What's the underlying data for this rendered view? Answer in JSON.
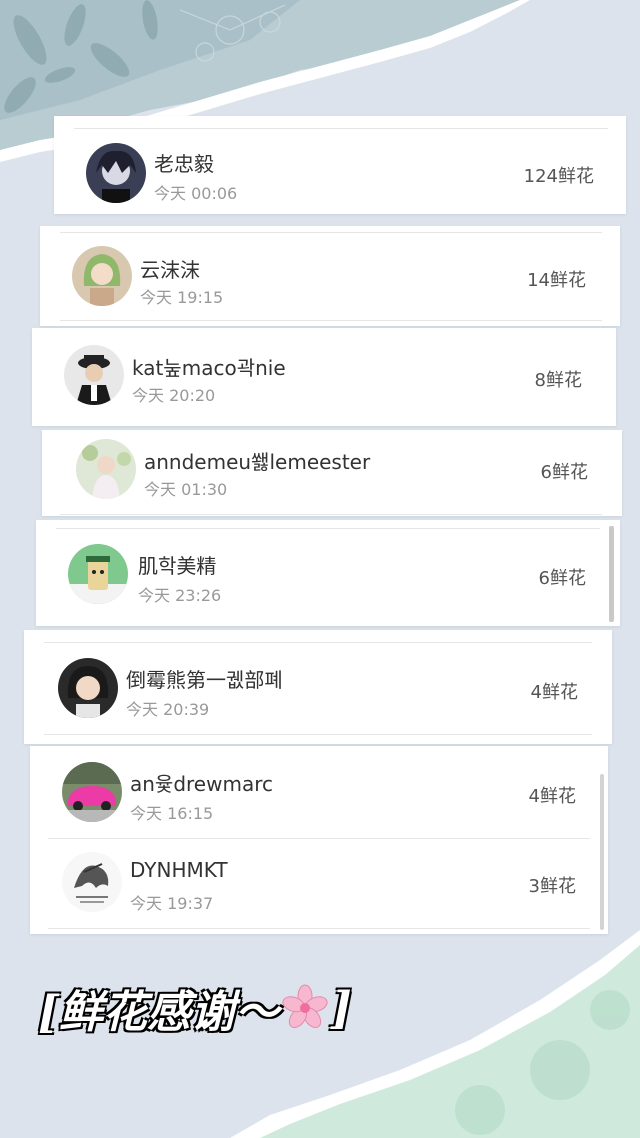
{
  "rows": [
    {
      "name": "老忠毅",
      "time": "今天 00:06",
      "flowers": "124鲜花",
      "avatar": "avatar-dark-anime"
    },
    {
      "name": "云沫沫",
      "time": "今天 19:15",
      "flowers": "14鲜花",
      "avatar": "avatar-green-hair"
    },
    {
      "name": "kat눞maco곽nie",
      "time": "今天 20:20",
      "flowers": "8鲜花",
      "avatar": "avatar-man-hat"
    },
    {
      "name": "anndemeu쐟lemeester",
      "time": "今天 01:30",
      "flowers": "6鲜花",
      "avatar": "avatar-girl-flowers"
    },
    {
      "name": "肌학美精",
      "time": "今天 23:26",
      "flowers": "6鲜花",
      "avatar": "avatar-cartoon-cup"
    },
    {
      "name": "倒霉熊第一궶部폐",
      "time": "今天 20:39",
      "flowers": "4鲜花",
      "avatar": "avatar-girl-portrait"
    },
    {
      "name": "an윷drewmarc",
      "time": "今天 16:15",
      "flowers": "4鲜花",
      "avatar": "avatar-pink-car"
    },
    {
      "name": "DYNHMKT",
      "time": "今天 19:37",
      "flowers": "3鲜花",
      "avatar": "avatar-ink-sketch"
    }
  ],
  "caption": {
    "open": "[鲜花感谢～",
    "close": "]",
    "icon": "cherry-blossom-icon"
  },
  "colors": {
    "background": "#dce3ec",
    "card": "#ffffff",
    "name": "#333333",
    "time": "#999999",
    "accent_green": "#cfe9dc"
  }
}
